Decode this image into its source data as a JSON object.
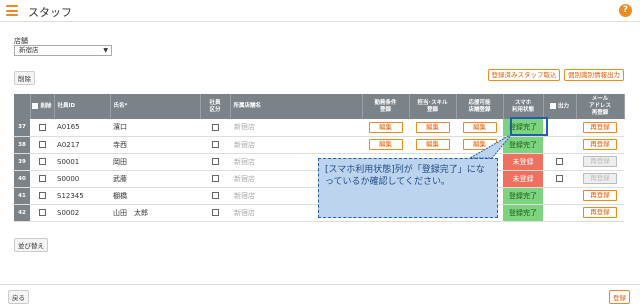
{
  "header": {
    "title": "スタッフ",
    "menu_icon": "hamburger-icon",
    "help_icon": "question-icon",
    "help_label": "?"
  },
  "store": {
    "label": "店舗",
    "selected": "新宿店",
    "arrow": "▼"
  },
  "toolbar": {
    "delete_label": "削除",
    "registered_fetch_label": "登録済みスタッフ取込",
    "export_label": "個別識別情報出力"
  },
  "columns": {
    "delete": "削除",
    "staff_id": "社員ID",
    "name": "氏名*",
    "employee_type_1": "社員",
    "employee_type_2": "区分",
    "store_name": "所属店舗名",
    "work_cond_1": "勤務条件",
    "work_cond_2": "登録",
    "skill_1": "担当･スキル",
    "skill_2": "登録",
    "support_1": "応援可能",
    "support_2": "店舗登録",
    "smart_1": "スマホ",
    "smart_2": "利用状態",
    "output": "出力",
    "mail_1": "メール",
    "mail_2": "アドレス",
    "mail_3": "再登録"
  },
  "rows": [
    {
      "num": "37",
      "id": "A0165",
      "name": "濱口",
      "store": "新宿店",
      "edit": [
        "編集",
        "編集",
        "編集"
      ],
      "status": "登録完了",
      "status_type": "done",
      "output_cb": false,
      "reg_label": "再登録",
      "reg_disabled": false
    },
    {
      "num": "38",
      "id": "A0217",
      "name": "寺西",
      "store": "新宿店",
      "edit": [
        "編集",
        "編集",
        "編集"
      ],
      "status": "登録完了",
      "status_type": "done",
      "output_cb": false,
      "reg_label": "再登録",
      "reg_disabled": false
    },
    {
      "num": "39",
      "id": "S0001",
      "name": "岡田",
      "store": "新宿店",
      "edit": [
        "",
        "",
        ""
      ],
      "status": "未登録",
      "status_type": "none",
      "output_cb": true,
      "reg_label": "再登録",
      "reg_disabled": true
    },
    {
      "num": "40",
      "id": "S0000",
      "name": "武藤",
      "store": "新宿店",
      "edit": [
        "",
        "",
        ""
      ],
      "status": "未登録",
      "status_type": "none",
      "output_cb": true,
      "reg_label": "再登録",
      "reg_disabled": true
    },
    {
      "num": "41",
      "id": "S12345",
      "name": "棚橋",
      "store": "新宿店",
      "edit": [
        "",
        "",
        ""
      ],
      "status": "登録完了",
      "status_type": "done",
      "output_cb": false,
      "reg_label": "再登録",
      "reg_disabled": false
    },
    {
      "num": "42",
      "id": "S0002",
      "name": "山田　太郎",
      "store": "新宿店",
      "edit": [
        "",
        "",
        ""
      ],
      "status": "登録完了",
      "status_type": "done",
      "output_cb": false,
      "reg_label": "再登録",
      "reg_disabled": false
    }
  ],
  "callout": {
    "text": "[スマホ利用状態]列が「登録完了」になっているか確認してください。"
  },
  "sort_label": "並び替え",
  "footer": {
    "back_label": "戻る",
    "register_label": "登録"
  },
  "colors": {
    "accent": "#f08a1e",
    "header_gray": "#7b8288",
    "done_green": "#7ed37e",
    "none_red": "#f07060",
    "callout_blue": "#bcd4ee"
  }
}
